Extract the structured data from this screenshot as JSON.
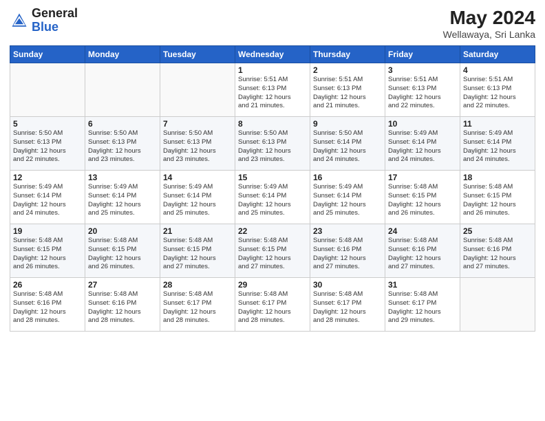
{
  "logo": {
    "general": "General",
    "blue": "Blue"
  },
  "title": {
    "month_year": "May 2024",
    "location": "Wellawaya, Sri Lanka"
  },
  "weekdays": [
    "Sunday",
    "Monday",
    "Tuesday",
    "Wednesday",
    "Thursday",
    "Friday",
    "Saturday"
  ],
  "weeks": [
    [
      {
        "day": "",
        "info": ""
      },
      {
        "day": "",
        "info": ""
      },
      {
        "day": "",
        "info": ""
      },
      {
        "day": "1",
        "info": "Sunrise: 5:51 AM\nSunset: 6:13 PM\nDaylight: 12 hours\nand 21 minutes."
      },
      {
        "day": "2",
        "info": "Sunrise: 5:51 AM\nSunset: 6:13 PM\nDaylight: 12 hours\nand 21 minutes."
      },
      {
        "day": "3",
        "info": "Sunrise: 5:51 AM\nSunset: 6:13 PM\nDaylight: 12 hours\nand 22 minutes."
      },
      {
        "day": "4",
        "info": "Sunrise: 5:51 AM\nSunset: 6:13 PM\nDaylight: 12 hours\nand 22 minutes."
      }
    ],
    [
      {
        "day": "5",
        "info": "Sunrise: 5:50 AM\nSunset: 6:13 PM\nDaylight: 12 hours\nand 22 minutes."
      },
      {
        "day": "6",
        "info": "Sunrise: 5:50 AM\nSunset: 6:13 PM\nDaylight: 12 hours\nand 23 minutes."
      },
      {
        "day": "7",
        "info": "Sunrise: 5:50 AM\nSunset: 6:13 PM\nDaylight: 12 hours\nand 23 minutes."
      },
      {
        "day": "8",
        "info": "Sunrise: 5:50 AM\nSunset: 6:13 PM\nDaylight: 12 hours\nand 23 minutes."
      },
      {
        "day": "9",
        "info": "Sunrise: 5:50 AM\nSunset: 6:14 PM\nDaylight: 12 hours\nand 24 minutes."
      },
      {
        "day": "10",
        "info": "Sunrise: 5:49 AM\nSunset: 6:14 PM\nDaylight: 12 hours\nand 24 minutes."
      },
      {
        "day": "11",
        "info": "Sunrise: 5:49 AM\nSunset: 6:14 PM\nDaylight: 12 hours\nand 24 minutes."
      }
    ],
    [
      {
        "day": "12",
        "info": "Sunrise: 5:49 AM\nSunset: 6:14 PM\nDaylight: 12 hours\nand 24 minutes."
      },
      {
        "day": "13",
        "info": "Sunrise: 5:49 AM\nSunset: 6:14 PM\nDaylight: 12 hours\nand 25 minutes."
      },
      {
        "day": "14",
        "info": "Sunrise: 5:49 AM\nSunset: 6:14 PM\nDaylight: 12 hours\nand 25 minutes."
      },
      {
        "day": "15",
        "info": "Sunrise: 5:49 AM\nSunset: 6:14 PM\nDaylight: 12 hours\nand 25 minutes."
      },
      {
        "day": "16",
        "info": "Sunrise: 5:49 AM\nSunset: 6:14 PM\nDaylight: 12 hours\nand 25 minutes."
      },
      {
        "day": "17",
        "info": "Sunrise: 5:48 AM\nSunset: 6:15 PM\nDaylight: 12 hours\nand 26 minutes."
      },
      {
        "day": "18",
        "info": "Sunrise: 5:48 AM\nSunset: 6:15 PM\nDaylight: 12 hours\nand 26 minutes."
      }
    ],
    [
      {
        "day": "19",
        "info": "Sunrise: 5:48 AM\nSunset: 6:15 PM\nDaylight: 12 hours\nand 26 minutes."
      },
      {
        "day": "20",
        "info": "Sunrise: 5:48 AM\nSunset: 6:15 PM\nDaylight: 12 hours\nand 26 minutes."
      },
      {
        "day": "21",
        "info": "Sunrise: 5:48 AM\nSunset: 6:15 PM\nDaylight: 12 hours\nand 27 minutes."
      },
      {
        "day": "22",
        "info": "Sunrise: 5:48 AM\nSunset: 6:15 PM\nDaylight: 12 hours\nand 27 minutes."
      },
      {
        "day": "23",
        "info": "Sunrise: 5:48 AM\nSunset: 6:16 PM\nDaylight: 12 hours\nand 27 minutes."
      },
      {
        "day": "24",
        "info": "Sunrise: 5:48 AM\nSunset: 6:16 PM\nDaylight: 12 hours\nand 27 minutes."
      },
      {
        "day": "25",
        "info": "Sunrise: 5:48 AM\nSunset: 6:16 PM\nDaylight: 12 hours\nand 27 minutes."
      }
    ],
    [
      {
        "day": "26",
        "info": "Sunrise: 5:48 AM\nSunset: 6:16 PM\nDaylight: 12 hours\nand 28 minutes."
      },
      {
        "day": "27",
        "info": "Sunrise: 5:48 AM\nSunset: 6:16 PM\nDaylight: 12 hours\nand 28 minutes."
      },
      {
        "day": "28",
        "info": "Sunrise: 5:48 AM\nSunset: 6:17 PM\nDaylight: 12 hours\nand 28 minutes."
      },
      {
        "day": "29",
        "info": "Sunrise: 5:48 AM\nSunset: 6:17 PM\nDaylight: 12 hours\nand 28 minutes."
      },
      {
        "day": "30",
        "info": "Sunrise: 5:48 AM\nSunset: 6:17 PM\nDaylight: 12 hours\nand 28 minutes."
      },
      {
        "day": "31",
        "info": "Sunrise: 5:48 AM\nSunset: 6:17 PM\nDaylight: 12 hours\nand 29 minutes."
      },
      {
        "day": "",
        "info": ""
      }
    ]
  ]
}
